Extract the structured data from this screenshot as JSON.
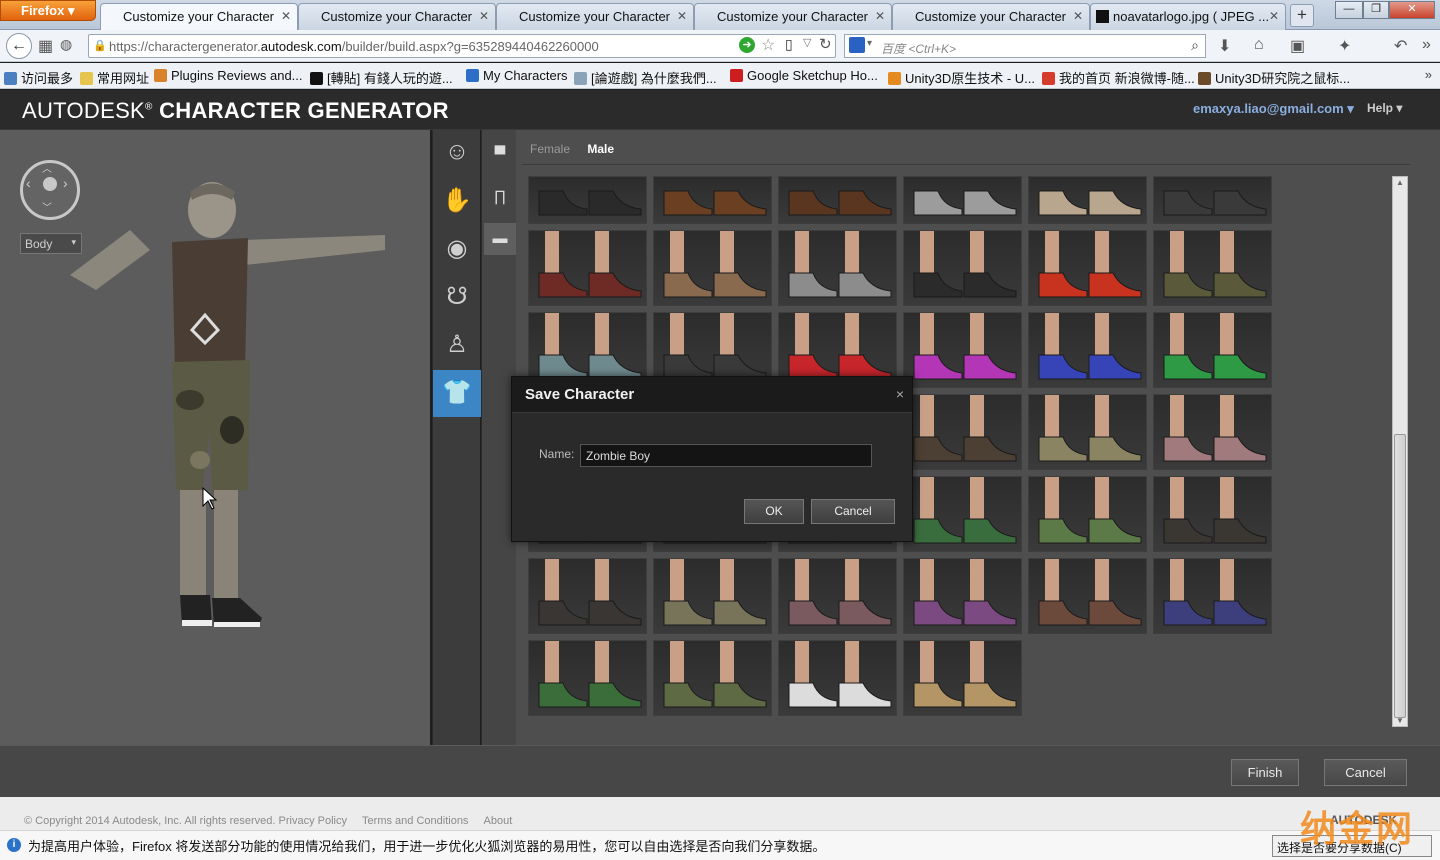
{
  "browser": {
    "menu_label": "Firefox ▾",
    "tabs": [
      {
        "label": "Customize your Character",
        "active": true
      },
      {
        "label": "Customize your Character",
        "active": false
      },
      {
        "label": "Customize your Character",
        "active": false
      },
      {
        "label": "Customize your Character",
        "active": false
      },
      {
        "label": "Customize your Character",
        "active": false
      },
      {
        "label": "noavatarlogo.jpg ( JPEG ...",
        "active": false
      }
    ],
    "url_prefix": "https://charactergenerator.",
    "url_domain": "autodesk.com",
    "url_path": "/builder/build.aspx?g=635289440462260000",
    "search_placeholder": "百度 <Ctrl+K>",
    "bookmarks": [
      {
        "label": "访问最多",
        "color": "#4a7fc1"
      },
      {
        "label": "常用网址",
        "color": "#e7c44b"
      },
      {
        "label": "Plugins Reviews and...",
        "color": "#d9822b"
      },
      {
        "label": "[轉貼] 有錢人玩的遊...",
        "color": "#111111"
      },
      {
        "label": "My Characters",
        "color": "#2d6fc7"
      },
      {
        "label": "[論遊戲] 為什麼我們...",
        "color": "#8aa3b8"
      },
      {
        "label": "Google Sketchup Ho...",
        "color": "#cc1e1e"
      },
      {
        "label": "Unity3D原生技术 - U...",
        "color": "#e58a1f"
      },
      {
        "label": "我的首页 新浪微博-随...",
        "color": "#d63c2c"
      },
      {
        "label": "Unity3D研究院之鼠标...",
        "color": "#6b4a2a"
      }
    ]
  },
  "app": {
    "logo_light": "AUTODESK",
    "logo_reg": "®",
    "logo_bold": " CHARACTER GENERATOR",
    "user_email": "emaxya.liao@gmail.com ▾",
    "help_label": "Help ▾",
    "body_select": "Body",
    "gender_tabs": {
      "female": "Female",
      "male": "Male",
      "selected": "Male"
    },
    "categories": [
      "face",
      "hands",
      "eyes",
      "hair",
      "body",
      "clothing"
    ],
    "active_category": "clothing",
    "subcategories": [
      "shirt",
      "pants",
      "shoes"
    ],
    "active_subcategory": "shoes",
    "shoe_grid": [
      [
        "#2a2a2a",
        "#6b3f22",
        "#5a3520",
        "#9c9c9c",
        "#b9a68f",
        "#3a3a3a"
      ],
      [
        "#6e2a24",
        "#8a6a4e",
        "#8c8c8c",
        "#2b2b2b",
        "#c8331f",
        "#5a5a3a"
      ],
      [
        "#6f8a8e",
        "#3a3a3a",
        "#c7262b",
        "#b236b5",
        "#3644b8",
        "#2f9a45"
      ],
      [
        "#3c3c3c",
        "#2a2a2a",
        "#3c3c3c",
        "#4c3f33",
        "#8a8462",
        "#a07a7c"
      ],
      [
        "#3c3c3c",
        "#3c3c3c",
        "#3c3c3c",
        "#3a6d3e",
        "#5c7a48",
        "#3a3632"
      ],
      [
        "#3a3633",
        "#77745a",
        "#7a5a5e",
        "#7a4a80",
        "#6b4a3c",
        "#3d3f7c"
      ],
      [
        "#3a6d3a",
        "#5e6a44",
        "#dcdcdc",
        "#b49565",
        null,
        null
      ]
    ],
    "footer_buttons": {
      "finish": "Finish",
      "cancel": "Cancel"
    },
    "copyright": "© Copyright 2014 Autodesk, Inc. All rights reserved. Privacy Policy",
    "terms": "Terms and Conditions",
    "about": "About",
    "footer_brand": "AUTODESK"
  },
  "dialog": {
    "title": "Save Character",
    "close_label": "×",
    "name_label": "Name:",
    "name_value": "Zombie Boy",
    "ok_label": "OK",
    "cancel_label": "Cancel"
  },
  "infobar": {
    "message": "为提高用户体验，Firefox 将发送部分功能的使用情况给我们，用于进一步优化火狐浏览器的易用性，您可以自由选择是否向我们分享数据。",
    "button_label": "选择是否要分享数据(C)"
  },
  "watermark": "纳金网"
}
